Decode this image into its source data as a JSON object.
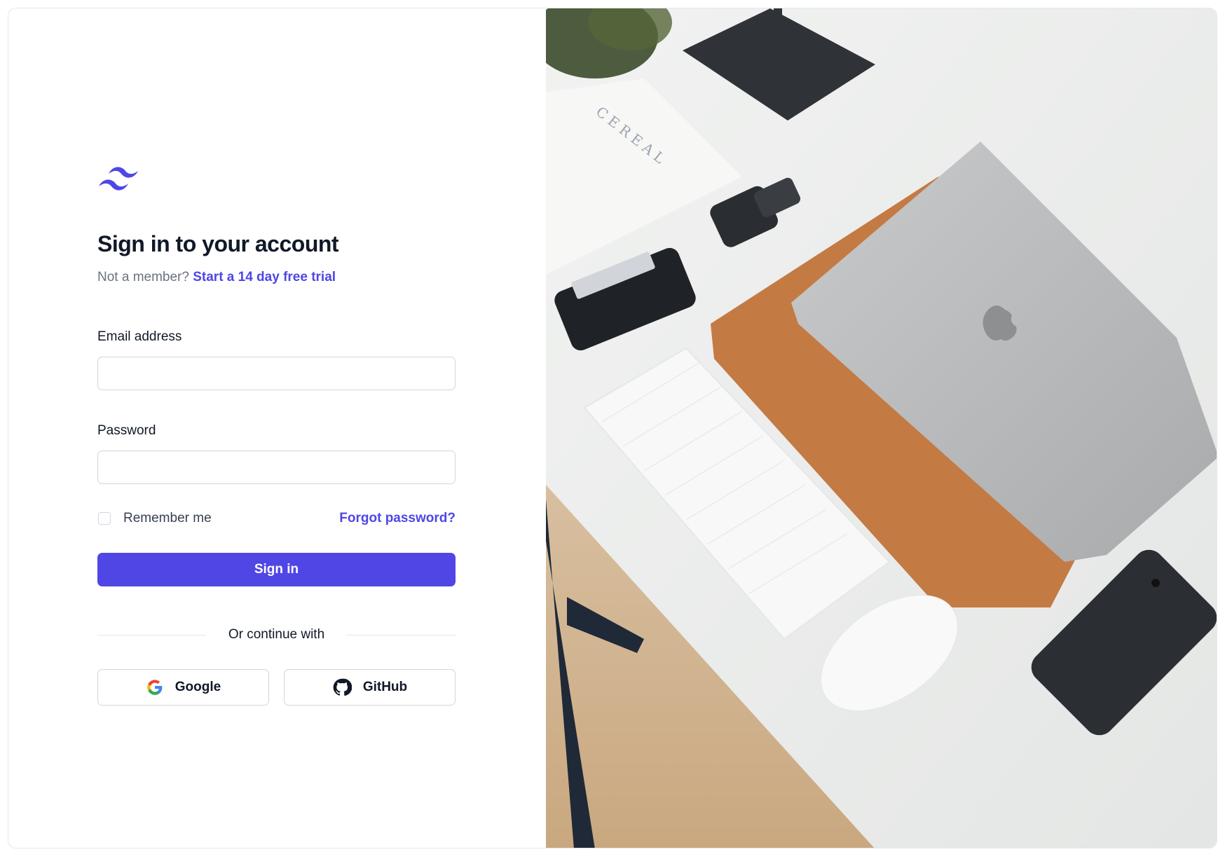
{
  "brand": {
    "logo_icon": "tailwind-logo-icon",
    "accent": "#4f46e5"
  },
  "header": {
    "title": "Sign in to your account",
    "subtitle_prefix": "Not a member?",
    "trial_link": "Start a 14 day free trial"
  },
  "form": {
    "email_label": "Email address",
    "email_value": "",
    "password_label": "Password",
    "password_value": "",
    "remember_label": "Remember me",
    "remember_checked": false,
    "forgot_link": "Forgot password?",
    "submit_label": "Sign in"
  },
  "social": {
    "divider_text": "Or continue with",
    "google_label": "Google",
    "github_label": "GitHub"
  },
  "hero_image": {
    "description_icon": "desk-workspace-photo"
  }
}
